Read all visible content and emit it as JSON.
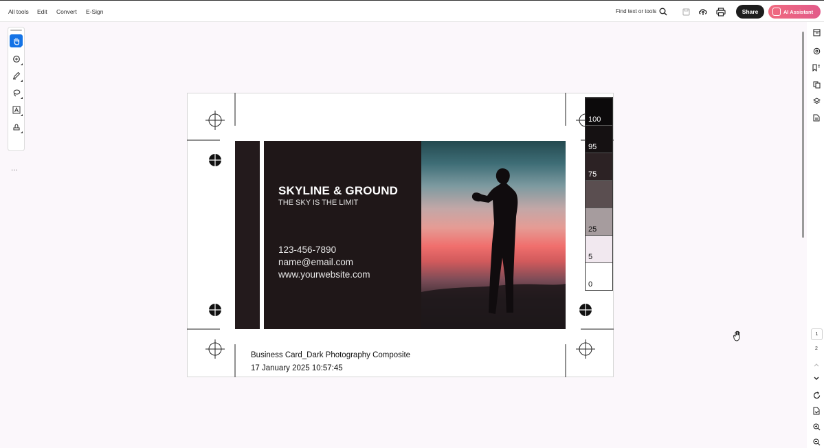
{
  "topbar": {
    "menu": [
      "All tools",
      "Edit",
      "Convert",
      "E-Sign"
    ],
    "find_label": "Find text or tools",
    "share_label": "Share",
    "ai_label": "AI Assistant"
  },
  "card": {
    "brand": "SKYLINE & GROUND",
    "tagline": "THE SKY IS THE LIMIT",
    "phone": "123-456-7890",
    "email": "name@email.com",
    "website": "www.yourwebsite.com"
  },
  "caption": {
    "title": "Business Card_Dark Photography Composite",
    "timestamp": "17 January 2025 10:57:45"
  },
  "color_bar": [
    {
      "label": "100",
      "color": "#0c0a0b",
      "text_color": "#ffffff"
    },
    {
      "label": "95",
      "color": "#151112",
      "text_color": "#ffffff"
    },
    {
      "label": "75",
      "color": "#2c2224",
      "text_color": "#ffffff"
    },
    {
      "label": "",
      "color": "#5a4e50",
      "text_color": "#ffffff"
    },
    {
      "label": "25",
      "color": "#a69c9e",
      "text_color": "#111111"
    },
    {
      "label": "5",
      "color": "#f1e8ef",
      "text_color": "#111111"
    },
    {
      "label": "0",
      "color": "#ffffff",
      "text_color": "#111111"
    }
  ],
  "pagination": {
    "current": "1",
    "next": "2"
  },
  "colors": {
    "accent": "#1473e6",
    "ai_gradient_start": "#f06a7f",
    "ai_gradient_end": "#e25b8a"
  }
}
